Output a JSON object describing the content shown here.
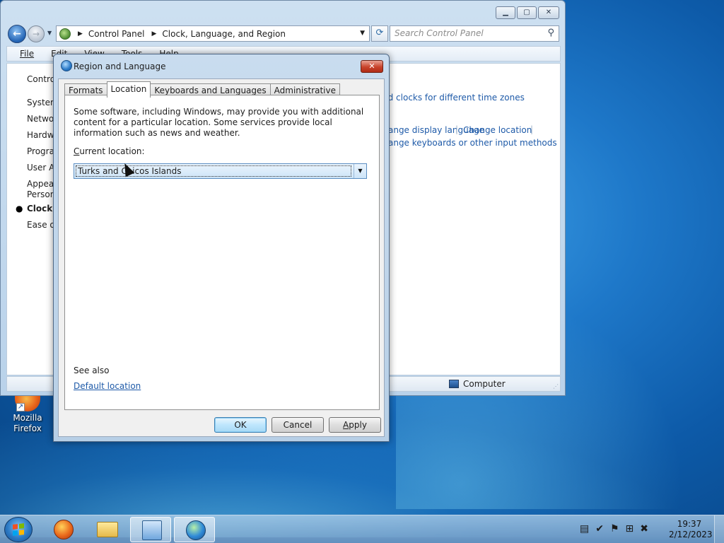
{
  "desktop": {
    "icons": [
      {
        "label_line1": "Mozilla",
        "label_line2": "Firefox"
      }
    ]
  },
  "explorer": {
    "breadcrumb": [
      "Control Panel",
      "Clock, Language, and Region"
    ],
    "search_placeholder": "Search Control Panel",
    "menu": [
      "File",
      "Edit",
      "View",
      "Tools",
      "Help"
    ],
    "sidebar": [
      {
        "label": "Control Panel Home",
        "current": false
      },
      {
        "label": "System and Security",
        "current": false
      },
      {
        "label": "Network and Internet",
        "current": false
      },
      {
        "label": "Hardware and Sound",
        "current": false
      },
      {
        "label": "Programs",
        "current": false
      },
      {
        "label": "User Accounts",
        "current": false
      },
      {
        "label": "Appearance and",
        "current": false
      },
      {
        "label": "Personalization",
        "current": false
      },
      {
        "label": "Clock, Language, and Region",
        "current": true
      },
      {
        "label": "Ease of Access",
        "current": false
      }
    ],
    "links": {
      "add_clocks": "Add clocks for different time zones",
      "display_language": "Change display language",
      "change_location": "Change location",
      "keyboards": "Change keyboards or other input methods"
    },
    "status_computer": "Computer"
  },
  "dialog": {
    "title": "Region and Language",
    "tabs": [
      {
        "label": "Formats",
        "active": false
      },
      {
        "label": "Location",
        "active": true
      },
      {
        "label": "Keyboards and Languages",
        "active": false
      },
      {
        "label": "Administrative",
        "active": false
      }
    ],
    "description": "Some software, including Windows, may provide you with additional content for a particular location. Some services provide local information such as news and weather.",
    "current_location_label_prefix": "C",
    "current_location_label_rest": "urrent location:",
    "current_location_value": "Turks and Caicos Islands",
    "see_also": "See also",
    "default_location_link": "Default location",
    "buttons": {
      "ok": "OK",
      "cancel": "Cancel",
      "apply_u": "A",
      "apply_rest": "pply"
    }
  },
  "taskbar": {
    "time": "19:37",
    "date": "2/12/2023"
  }
}
